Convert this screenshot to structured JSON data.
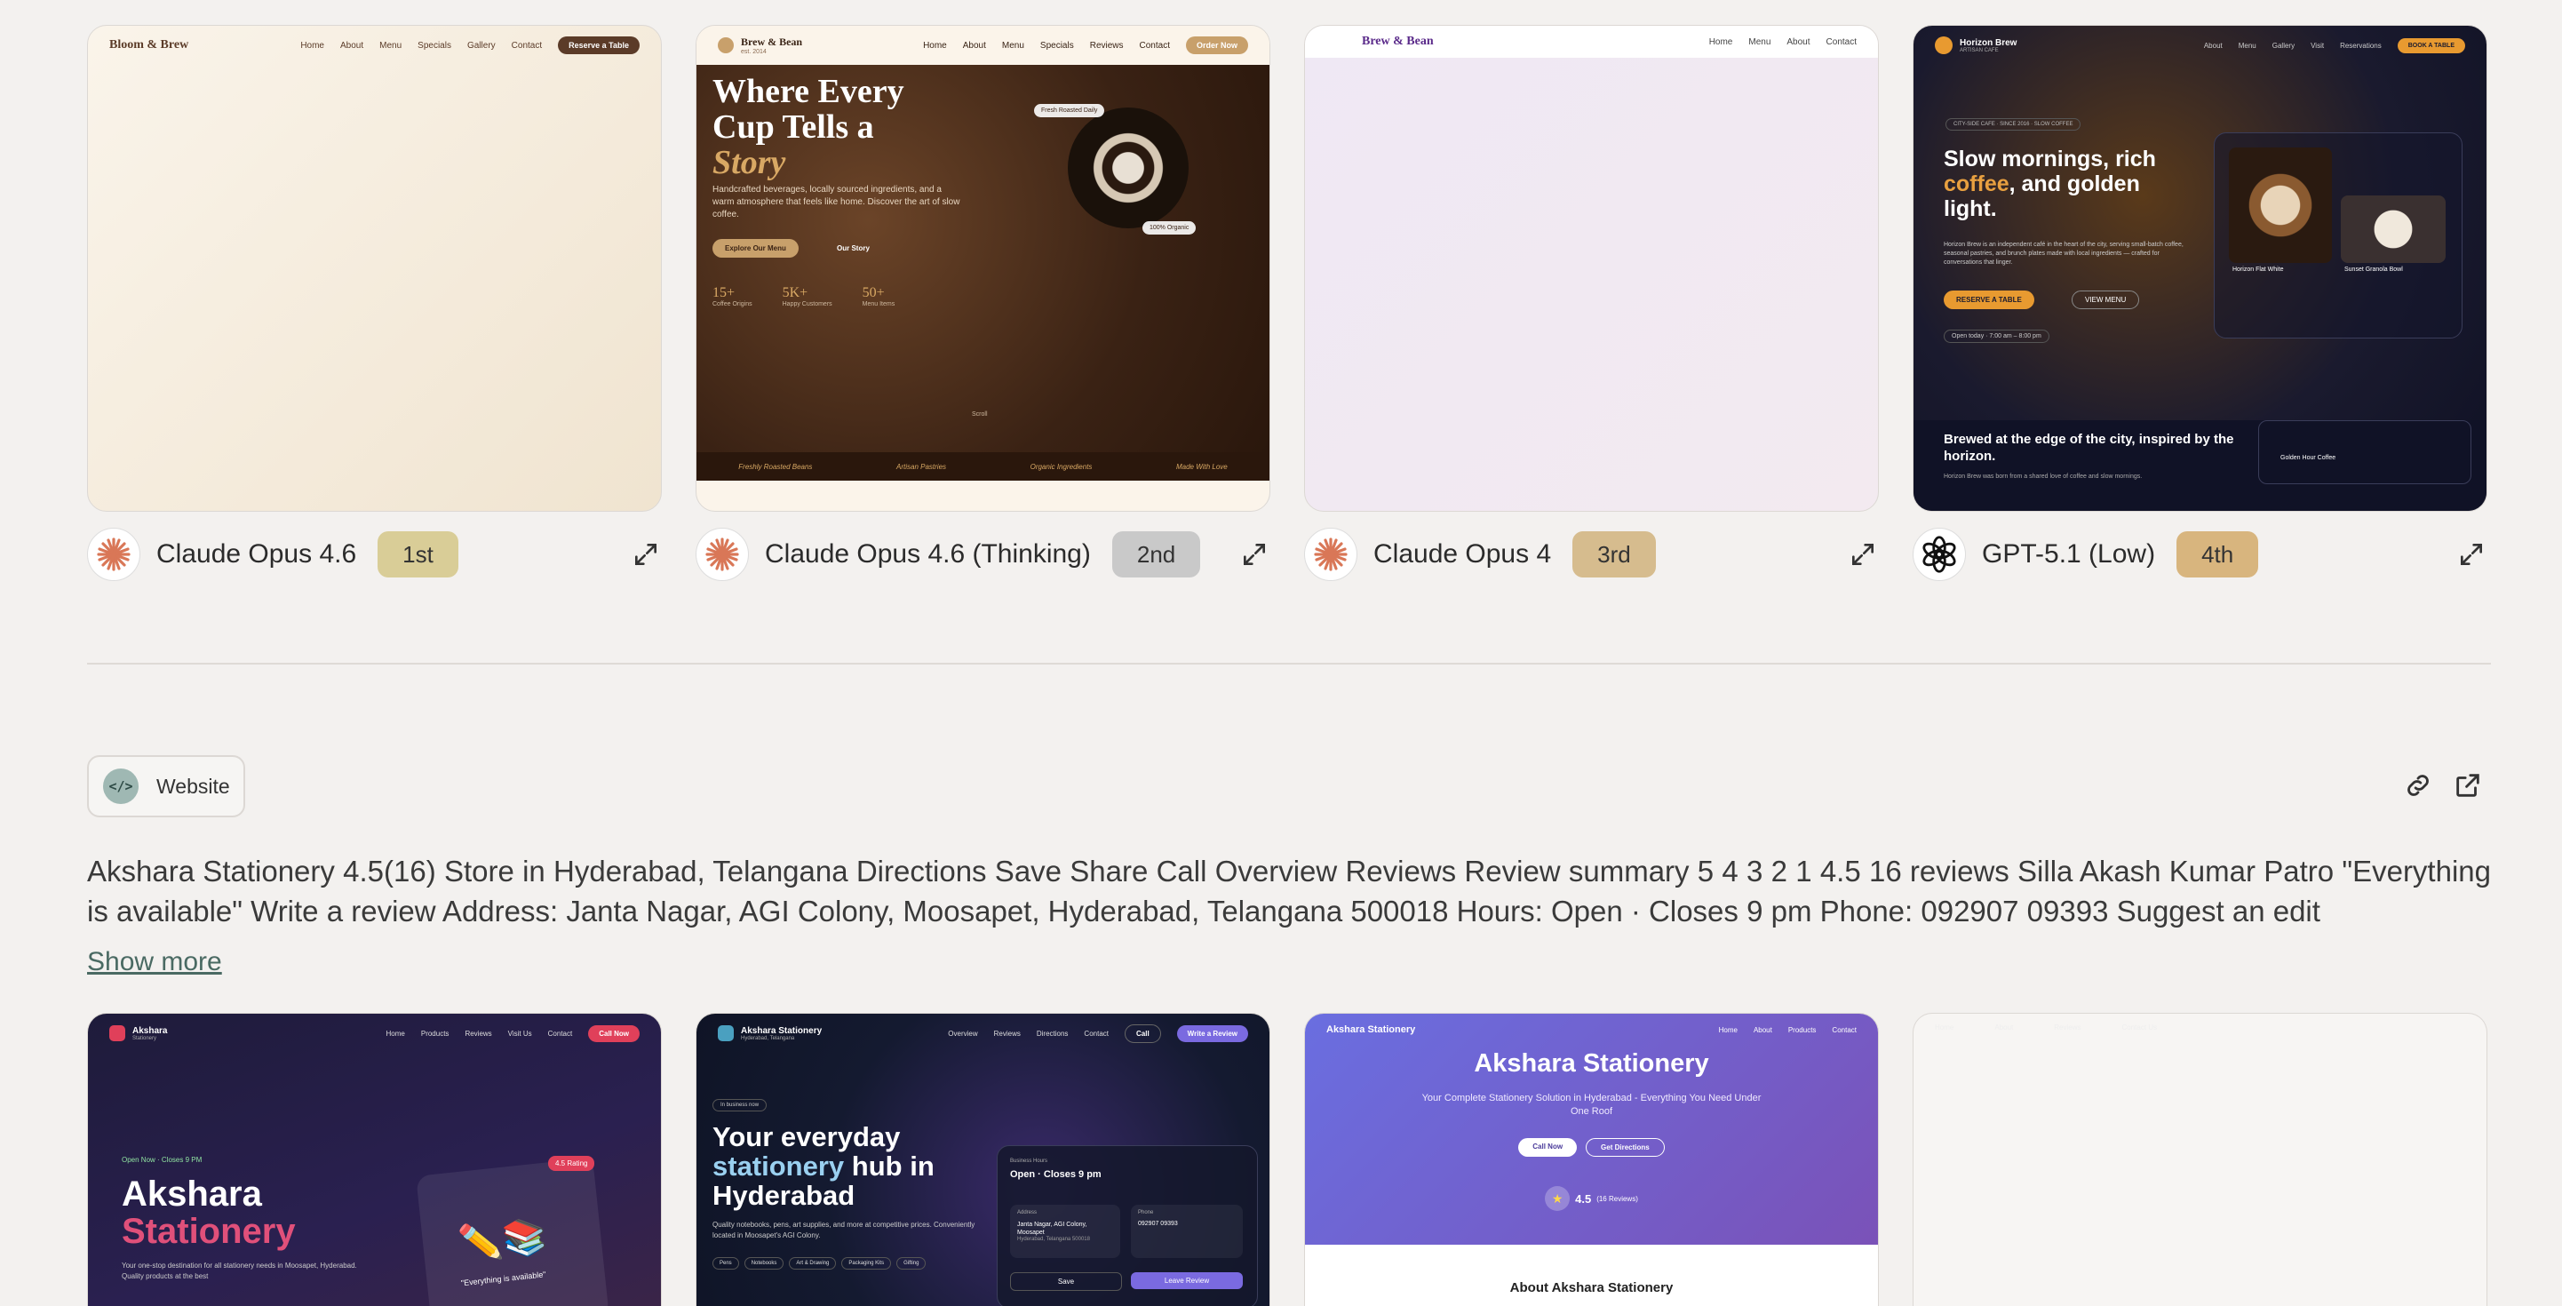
{
  "top_cards": [
    {
      "model": "Claude Opus 4.6",
      "rank": "1st",
      "badge_color": "#d9cd97",
      "logo": "claude-icon",
      "preview": {
        "brand": "Bloom & Brew",
        "nav": [
          "Home",
          "About",
          "Menu",
          "Specials",
          "Gallery",
          "Contact"
        ],
        "cta": "Reserve a Table"
      }
    },
    {
      "model": "Claude Opus 4.6 (Thinking)",
      "rank": "2nd",
      "badge_color": "#c9c9c9",
      "logo": "claude-icon",
      "preview": {
        "brand": "Brew & Bean",
        "tagline": "est. 2014",
        "nav": [
          "Home",
          "About",
          "Menu",
          "Specials",
          "Reviews",
          "Contact"
        ],
        "cta": "Order Now",
        "heading_1": "Where Every",
        "heading_2": "Cup Tells a",
        "heading_3": "Story",
        "sub": "Handcrafted beverages, locally sourced ingredients, and a warm atmosphere that feels like home. Discover the art of slow coffee.",
        "btn_primary": "Explore Our Menu",
        "btn_secondary": "Our Story",
        "stats": [
          {
            "n": "15+",
            "l": "Coffee Origins"
          },
          {
            "n": "5K+",
            "l": "Happy Customers"
          },
          {
            "n": "50+",
            "l": "Menu Items"
          }
        ],
        "chip_1": "Fresh Roasted Daily",
        "chip_2": "100% Organic",
        "scroll": "Scroll",
        "ticker": [
          "Freshly Roasted Beans",
          "Artisan Pastries",
          "Organic Ingredients",
          "Made With Love"
        ]
      }
    },
    {
      "model": "Claude Opus 4",
      "rank": "3rd",
      "badge_color": "#d6bc8e",
      "logo": "claude-icon",
      "preview": {
        "brand": "Brew & Bean",
        "nav": [
          "Home",
          "Menu",
          "About",
          "Contact"
        ]
      }
    },
    {
      "model": "GPT-5.1 (Low)",
      "rank": "4th",
      "badge_color": "#d8b57e",
      "logo": "openai-icon",
      "preview": {
        "brand": "Horizon Brew",
        "brand_sub": "ARTISAN CAFE",
        "nav": [
          "About",
          "Menu",
          "Gallery",
          "Visit",
          "Reservations"
        ],
        "cta": "BOOK A TABLE",
        "kicker": "CITY-SIDE CAFE · SINCE 2016 · SLOW COFFEE",
        "h1": "Slow mornings, rich",
        "h2_accent": "coffee",
        "h2_rest": ", and golden",
        "h3": "light.",
        "sub": "Horizon Brew is an independent café in the heart of the city, serving small-batch coffee, seasonal pastries, and brunch plates made with local ingredients — crafted for conversations that linger.",
        "btn_primary": "RESERVE A TABLE",
        "btn_secondary": "VIEW MENU",
        "hours": "Open today · 7:00 am – 8:00 pm",
        "item_1": "Horizon Flat White",
        "item_2": "Sunset Granola Bowl",
        "section_h": "Brewed at the edge of the city, inspired by the horizon.",
        "section_p": "Horizon Brew was born from a shared love of coffee and slow mornings.",
        "card_title": "Golden Hour Coffee"
      }
    }
  ],
  "tag": {
    "icon": "code-icon",
    "label": "Website"
  },
  "description": "Akshara Stationery 4.5(16) Store in Hyderabad, Telangana Directions Save Share Call Overview Reviews Review summary 5 4 3 2 1 4.5 16 reviews Silla Akash Kumar Patro \"Everything is available\" Write a review Address: Janta Nagar, AGI Colony, Moosapet, Hyderabad, Telangana 500018 Hours: Open · Closes 9 pm Phone: 092907 09393 Suggest an edit",
  "show_more": "Show more",
  "bottom_cards": [
    {
      "brand": "Akshara",
      "brand_sub": "Stationery",
      "nav": [
        "Home",
        "Products",
        "Reviews",
        "Visit Us",
        "Contact"
      ],
      "cta": "Call Now",
      "open": "Open Now · Closes 9 PM",
      "h1": "Akshara",
      "h2": "Stationery",
      "rating": "4.5 Rating",
      "sub": "Your one-stop destination for all stationery needs in Moosapet, Hyderabad. Quality products at the best",
      "quote": "\"Everything is available\""
    },
    {
      "brand": "Akshara Stationery",
      "brand_sub": "Hyderabad, Telangana",
      "nav": [
        "Overview",
        "Reviews",
        "Directions",
        "Contact"
      ],
      "call": "Call",
      "cta": "Write a Review",
      "pill": "In business now",
      "h1": "Your everyday",
      "h2_accent": "stationery",
      "h2_rest": " hub in",
      "h3": "Hyderabad",
      "sub": "Quality notebooks, pens, art supplies, and more at competitive prices. Conveniently located in Moosapet's AGI Colony.",
      "chips": [
        "Pens",
        "Notebooks",
        "Art & Drawing",
        "Packaging Kits",
        "Gifting"
      ],
      "hours_label": "Business Hours",
      "hours": "Open · Closes 9 pm",
      "addr_label": "Address",
      "addr": "Janta Nagar, AGI Colony, Moosapet",
      "addr2": "Hyderabad, Telangana 500018",
      "phone_label": "Phone",
      "phone": "092907 09393",
      "save": "Save",
      "leave": "Leave Review"
    },
    {
      "brand": "Akshara Stationery",
      "nav": [
        "Home",
        "About",
        "Products",
        "Contact"
      ],
      "h1": "Akshara Stationery",
      "sub": "Your Complete Stationery Solution in Hyderabad - Everything You Need Under One Roof",
      "btn_1": "Call Now",
      "btn_2": "Get Directions",
      "rating": "4.5",
      "reviews": "(16 Reviews)",
      "section": "About Akshara Stationery"
    },
    {
      "nav": [
        "Home",
        "About",
        "Reviews",
        "Contact Us"
      ]
    }
  ],
  "colors": {
    "bg": "#f3f1ef",
    "accent": "#4a6a63",
    "claude": "#d97757"
  }
}
